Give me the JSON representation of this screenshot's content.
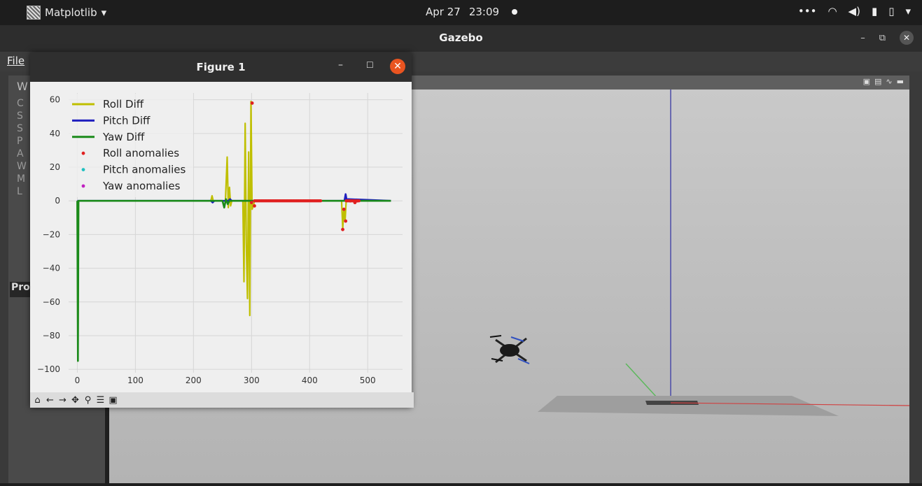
{
  "topbar": {
    "app_name": "Matplotlib",
    "date": "Apr 27",
    "time": "23:09",
    "tray_icons": [
      "more-icon",
      "wifi-icon",
      "volume-icon",
      "mic-icon",
      "battery-icon",
      "chevron-down-icon"
    ]
  },
  "gazebo": {
    "title": "Gazebo",
    "menu_file": "File",
    "left_panel_tab": "Pro",
    "left_panel_partial_label": "W",
    "left_panel_letters": [
      "C",
      "S",
      "S",
      "P",
      "A",
      "W",
      "M",
      "L"
    ]
  },
  "figure": {
    "title": "Figure 1",
    "toolbar": [
      "home-icon",
      "back-icon",
      "forward-icon",
      "pan-icon",
      "zoom-icon",
      "configure-icon",
      "save-icon"
    ]
  },
  "chart_data": {
    "type": "line",
    "xlim": [
      -15,
      560
    ],
    "ylim": [
      -102,
      64
    ],
    "xticks": [
      0,
      100,
      200,
      300,
      400,
      500
    ],
    "yticks": [
      60,
      40,
      20,
      0,
      -20,
      -40,
      -60,
      -80,
      -100
    ],
    "ytick_labels": [
      "60",
      "40",
      "20",
      "0",
      "−20",
      "−40",
      "−60",
      "−80",
      "−100"
    ],
    "grid": true,
    "legend_position": "top-left",
    "legend": [
      "Roll Diff",
      "Pitch Diff",
      "Yaw Diff",
      "Roll anomalies",
      "Pitch anomalies",
      "Yaw anomalies"
    ],
    "series": [
      {
        "name": "Roll Diff",
        "color": "#bfbf00",
        "x": [
          0,
          1,
          2,
          230,
          232,
          234,
          255,
          258,
          260,
          262,
          264,
          266,
          285,
          287,
          289,
          291,
          293,
          295,
          297,
          299,
          301,
          303,
          305,
          455,
          457,
          459,
          461,
          463,
          465,
          540
        ],
        "y": [
          0,
          -95,
          0,
          0,
          3,
          0,
          0,
          26,
          -4,
          8,
          -3,
          0,
          0,
          -48,
          46,
          -25,
          -58,
          29,
          -68,
          59,
          -5,
          -3,
          0,
          0,
          -16,
          -5,
          -12,
          0,
          0,
          0
        ]
      },
      {
        "name": "Pitch Diff",
        "color": "#1f1fbf",
        "x": [
          0,
          230,
          233,
          236,
          260,
          263,
          266,
          460,
          462,
          464,
          466,
          540
        ],
        "y": [
          0,
          0,
          -1,
          0,
          0,
          1,
          0,
          0,
          4,
          0,
          1,
          0
        ]
      },
      {
        "name": "Yaw Diff",
        "color": "#1a8a1a",
        "x": [
          0,
          1,
          2,
          250,
          253,
          256,
          259,
          262,
          540
        ],
        "y": [
          0,
          -95,
          0,
          0,
          -4,
          1,
          -2,
          0,
          0
        ]
      }
    ],
    "anomalies": [
      {
        "name": "Roll anomalies",
        "color": "#e02020",
        "points": [
          [
            301,
            58
          ],
          [
            305,
            -3
          ],
          [
            300,
            -1
          ],
          [
            457,
            -17
          ],
          [
            459,
            -5
          ],
          [
            462,
            -12
          ],
          [
            470,
            0
          ],
          [
            478,
            -1
          ],
          [
            482,
            0
          ]
        ],
        "dense_ranges": [
          [
            305,
            420
          ],
          [
            463,
            485
          ]
        ]
      },
      {
        "name": "Pitch anomalies",
        "color": "#20c0c0",
        "points": []
      },
      {
        "name": "Yaw anomalies",
        "color": "#c020c0",
        "points": []
      }
    ]
  }
}
